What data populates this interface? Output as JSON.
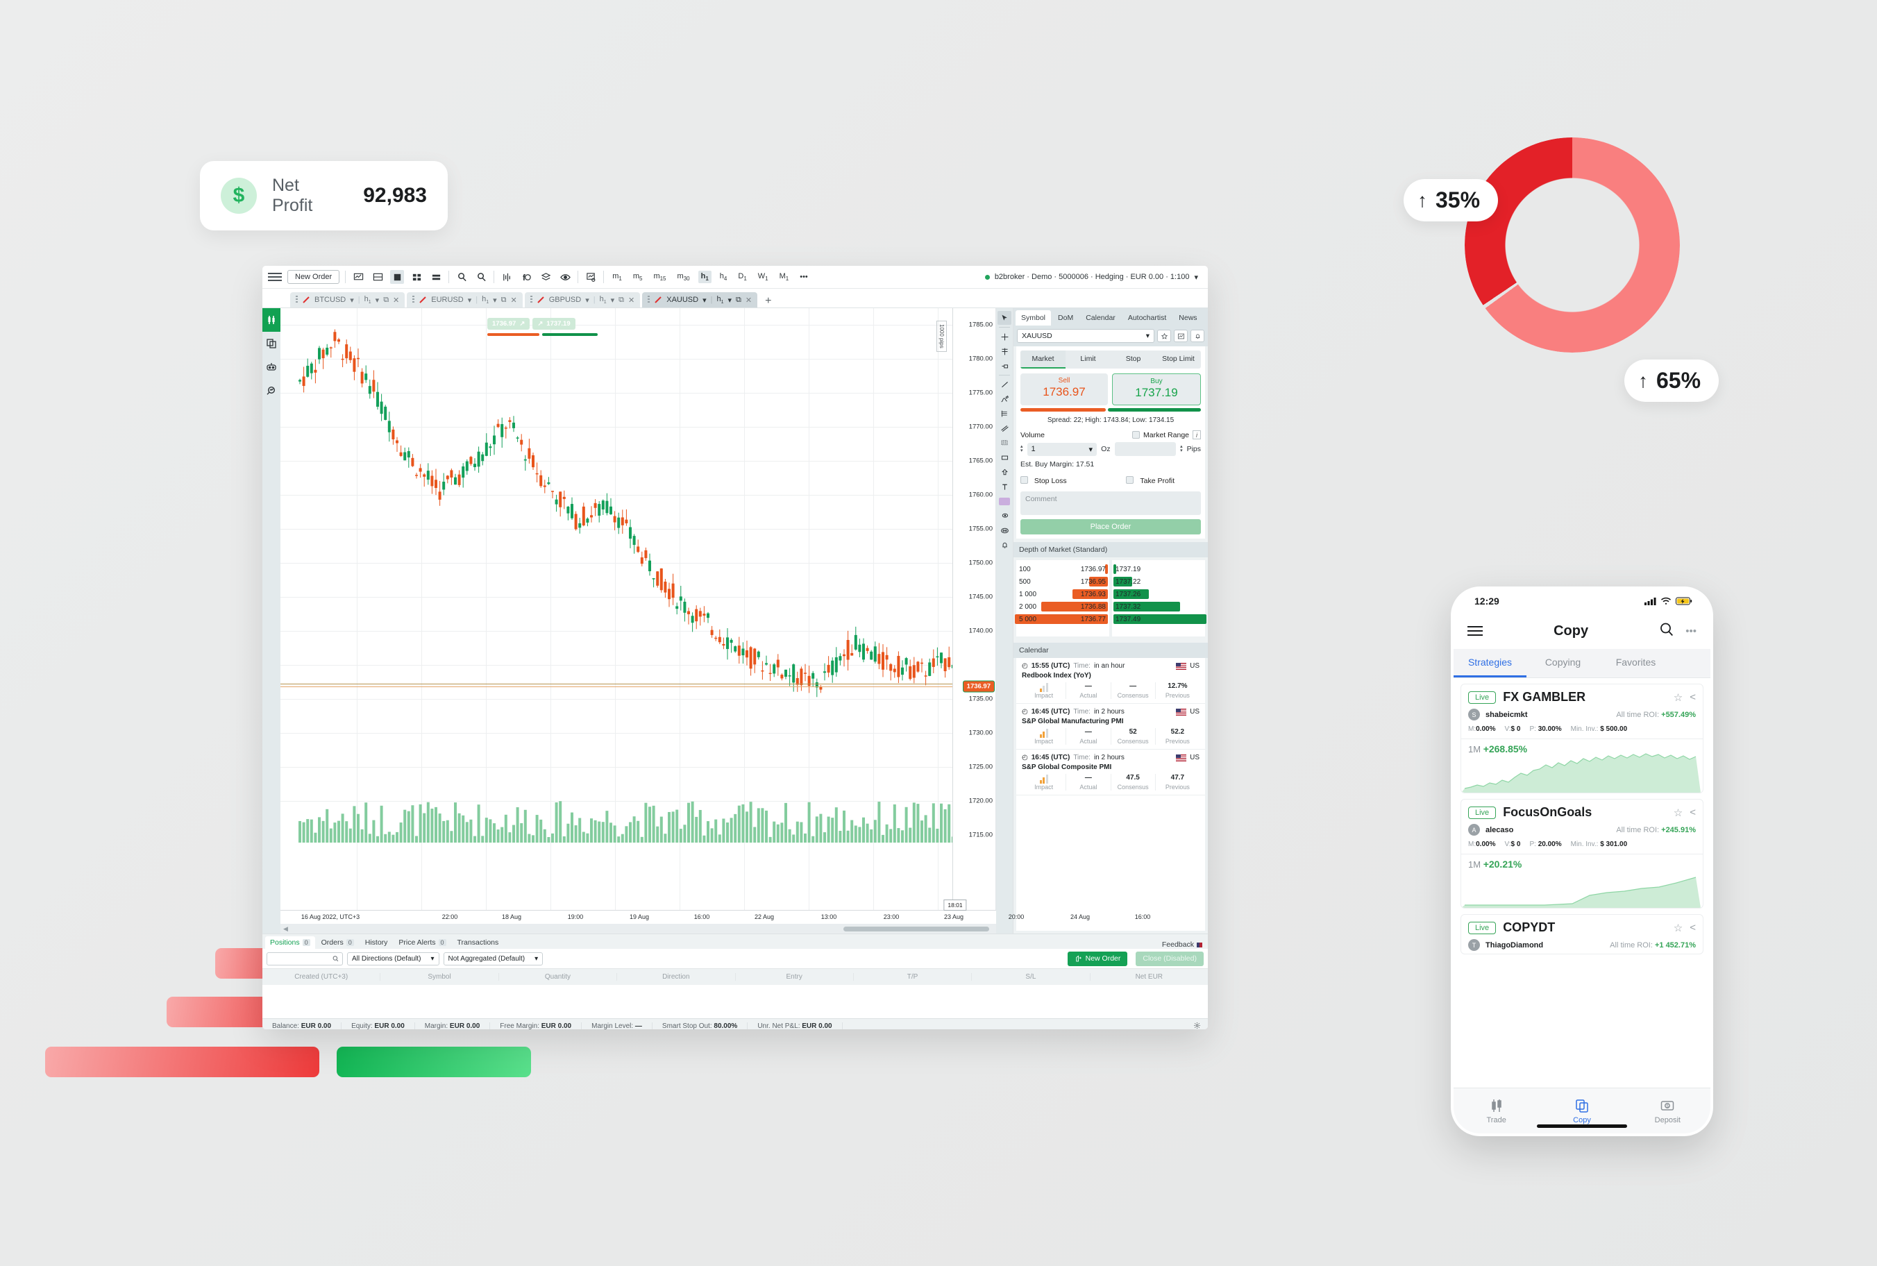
{
  "net_profit_card": {
    "icon": "dollar-icon",
    "label": "Net Profit",
    "value": "92,983"
  },
  "donut": {
    "top_label": "35%",
    "bottom_label": "65%",
    "arrow": "↑",
    "colors": {
      "primary": "#e32128",
      "secondary": "#f97f7f"
    }
  },
  "chart_data": {
    "type": "candlestick",
    "title": "XAUUSD h1",
    "symbol": "XAUUSD",
    "timeframe": "h1",
    "xlabel": "16 Aug 2022, UTC+3",
    "ylabel": "",
    "ylim": [
      1710,
      1788
    ],
    "y_ticks": [
      "1785.00",
      "1780.00",
      "1775.00",
      "1770.00",
      "1765.00",
      "1760.00",
      "1755.00",
      "1750.00",
      "1745.00",
      "1740.00",
      "1735.00",
      "1730.00",
      "1725.00",
      "1720.00",
      "1715.00"
    ],
    "x_ticks": [
      "16 Aug 2022, UTC+3",
      "22:00",
      "18 Aug",
      "19:00",
      "19 Aug",
      "16:00",
      "22 Aug",
      "13:00",
      "23:00",
      "23 Aug",
      "20:00",
      "24 Aug",
      "16:00"
    ],
    "last_price_label": "1736.97",
    "crosshair_label": "18:01",
    "scale_note": "1000 pips",
    "top_bid_label": "1736.97",
    "top_ask_label": "1737.19",
    "grid": true,
    "series": [
      {
        "name": "XAUUSD h1 OHLC",
        "note": "Downtrend from ~1784 to ~1735 across 16–24 Aug 2022"
      }
    ],
    "volume_note": "Volume histogram below price panel (green)"
  },
  "app": {
    "toolbar": {
      "menu_icon": "hamburger-icon",
      "new_order": "New Order",
      "icons": [
        "chart-screen-icon",
        "split-screen-icon",
        "fill-square-icon",
        "grid-4-icon",
        "grid-2-icon",
        "zoom-in-icon",
        "zoom-out-icon",
        "indicator-icon",
        "fibonacci-icon",
        "layers-icon",
        "eye-icon",
        "chart-settings-icon"
      ],
      "timeframes": [
        {
          "label": "m",
          "sub": "1",
          "active": false
        },
        {
          "label": "m",
          "sub": "5",
          "active": false
        },
        {
          "label": "m",
          "sub": "15",
          "active": false
        },
        {
          "label": "m",
          "sub": "30",
          "active": false
        },
        {
          "label": "h",
          "sub": "1",
          "active": true
        },
        {
          "label": "h",
          "sub": "4",
          "active": false
        },
        {
          "label": "D",
          "sub": "1",
          "active": false
        },
        {
          "label": "W",
          "sub": "1",
          "active": false
        },
        {
          "label": "M",
          "sub": "1",
          "active": false
        }
      ],
      "more": "•••",
      "account": "b2broker · Demo · 5000006 · Hedging · EUR 0.00 · 1:100"
    },
    "chart_tabs": [
      {
        "symbol": "BTCUSD",
        "tf": "h1",
        "active": false
      },
      {
        "symbol": "EURUSD",
        "tf": "h1",
        "active": false
      },
      {
        "symbol": "GBPUSD",
        "tf": "h1",
        "active": false
      },
      {
        "symbol": "XAUUSD",
        "tf": "h1",
        "active": true
      }
    ],
    "add_tab": "+",
    "left_rail": [
      "candlestick-icon",
      "copy-icon",
      "robot-icon",
      "search-chart-icon"
    ],
    "draw_tools": [
      "cursor-icon",
      "crosshair-icon",
      "magnet-icon",
      "anchor-icon",
      "trendline-icon",
      "freehand-icon",
      "fibonacci-icon",
      "parallel-channel-icon",
      "grid-icon",
      "rectangle-icon",
      "arrow-up-icon",
      "text-icon",
      "color-swatch-icon",
      "ellipse-icon",
      "emoji-icon",
      "alert-bell-icon"
    ],
    "right_panel": {
      "tabs": [
        "Symbol",
        "DoM",
        "Calendar",
        "Autochartist",
        "News"
      ],
      "active_tab": "Symbol",
      "symbol_select": "XAUUSD",
      "symbol_actions": [
        "star-icon",
        "chart-icon",
        "bell-icon"
      ],
      "order_types": [
        "Market",
        "Limit",
        "Stop",
        "Stop Limit"
      ],
      "active_order_type": "Market",
      "sell": {
        "label": "Sell",
        "price": "1736.97"
      },
      "buy": {
        "label": "Buy",
        "price": "1737.19"
      },
      "spread_line": "Spread: 22; High: 1743.84; Low: 1734.15",
      "volume_label": "Volume",
      "volume_value": "1",
      "volume_unit": "Oz",
      "market_range_label": "Market Range",
      "market_range_info": "i",
      "pips_label": "Pips",
      "est_margin": "Est. Buy Margin: 17.51",
      "stop_loss": "Stop Loss",
      "take_profit": "Take Profit",
      "comment_placeholder": "Comment",
      "place_order": "Place Order",
      "dom_header": "Depth of Market (Standard)",
      "dom_ask_rows": [
        {
          "qty": "100",
          "price": "1736.97",
          "width": 3
        },
        {
          "qty": "500",
          "price": "1736.95",
          "width": 20
        },
        {
          "qty": "1 000",
          "price": "1736.93",
          "width": 38
        },
        {
          "qty": "2 000",
          "price": "1736.88",
          "width": 72
        },
        {
          "qty": "5 000",
          "price": "1736.77",
          "width": 100
        }
      ],
      "dom_bid_rows": [
        {
          "price": "1737.19",
          "width": 3
        },
        {
          "price": "1737.22",
          "width": 20
        },
        {
          "price": "1737.26",
          "width": 38
        },
        {
          "price": "1737.32",
          "width": 72
        },
        {
          "price": "1737.49",
          "width": 100
        }
      ],
      "calendar_header": "Calendar",
      "calendar_columns": [
        "Impact",
        "Actual",
        "Consensus",
        "Previous"
      ],
      "calendar_items": [
        {
          "time": "15:55 (UTC)",
          "time_label": "Time:",
          "when": "in an hour",
          "country": "US",
          "title": "Redbook Index (YoY)",
          "impact": 1,
          "actual": "—",
          "consensus": "—",
          "previous": "12.7%"
        },
        {
          "time": "16:45 (UTC)",
          "time_label": "Time:",
          "when": "in 2 hours",
          "country": "US",
          "title": "S&P Global Manufacturing PMI",
          "impact": 2,
          "actual": "—",
          "consensus": "52",
          "previous": "52.2"
        },
        {
          "time": "16:45 (UTC)",
          "time_label": "Time:",
          "when": "in 2 hours",
          "country": "US",
          "title": "S&P Global Composite PMI",
          "impact": 2,
          "actual": "—",
          "consensus": "47.5",
          "previous": "47.7"
        }
      ]
    },
    "bottom": {
      "tabs": [
        {
          "label": "Positions",
          "count": "0",
          "active": true
        },
        {
          "label": "Orders",
          "count": "0",
          "active": false
        },
        {
          "label": "History",
          "count": "",
          "active": false
        },
        {
          "label": "Price Alerts",
          "count": "0",
          "active": false
        },
        {
          "label": "Transactions",
          "count": "",
          "active": false
        }
      ],
      "feedback": "Feedback",
      "search_placeholder": "",
      "direction_filter": "All Directions (Default)",
      "aggregation_filter": "Not Aggregated (Default)",
      "new_order": "New Order",
      "close_disabled": "Close (Disabled)",
      "columns": [
        "Created (UTC+3)",
        "Symbol",
        "Quantity",
        "Direction",
        "Entry",
        "T/P",
        "S/L",
        "Net EUR"
      ]
    },
    "status": [
      {
        "key": "Balance:",
        "value": "EUR 0.00"
      },
      {
        "key": "Equity:",
        "value": "EUR 0.00"
      },
      {
        "key": "Margin:",
        "value": "EUR 0.00"
      },
      {
        "key": "Free Margin:",
        "value": "EUR 0.00"
      },
      {
        "key": "Margin Level:",
        "value": "—"
      },
      {
        "key": "Smart Stop Out:",
        "value": "80.00%"
      },
      {
        "key": "Unr. Net P&L:",
        "value": "EUR 0.00"
      }
    ],
    "status_gear": "gear-icon"
  },
  "phone": {
    "status_time": "12:29",
    "status_icons": [
      "signal-icon",
      "wifi-icon",
      "battery-charging-icon"
    ],
    "nav": {
      "menu": "hamburger-icon",
      "title": "Copy",
      "search": "search-icon",
      "more": "more-icon"
    },
    "tabs": [
      {
        "label": "Strategies",
        "active": true
      },
      {
        "label": "Copying",
        "active": false
      },
      {
        "label": "Favorites",
        "active": false
      }
    ],
    "strategies": [
      {
        "badge": "Live",
        "name": "FX GAMBLER",
        "avatar": "S",
        "user": "shabeicmkt",
        "roi_label": "All time ROI:",
        "roi": "+557.49%",
        "m_label": "M:",
        "m": "0.00%",
        "v_label": "V:",
        "v": "$ 0",
        "p_label": "P:",
        "p": "30.00%",
        "min_label": "Min. Inv.:",
        "min": "$ 500.00",
        "period": "1M",
        "perf": "+268.85%",
        "spark": "5,52 14,50 23,47 32,49 41,44 50,46 59,40 68,43 77,36 86,30 95,33 104,26 113,24 122,18 131,22 140,15 149,19 158,12 167,16 176,9 185,13 194,7 203,11 212,5 221,9 230,4 239,8 248,3 257,7 266,2 275,6 284,3 293,8 302,4 311,9 320,5 329,10 338,6"
      },
      {
        "badge": "Live",
        "name": "FocusOnGoals",
        "avatar": "A",
        "user": "alecaso",
        "roi_label": "All time ROI:",
        "roi": "+245.91%",
        "m_label": "M:",
        "m": "0.00%",
        "v_label": "V:",
        "v": "$ 0",
        "p_label": "P:",
        "p": "20.00%",
        "min_label": "Min. Inv.:",
        "min": "$ 301.00",
        "period": "1M",
        "perf": "+20.21%",
        "spark": "5,54 60,54 120,54 160,52 185,40 210,36 235,34 260,30 285,28 310,22 338,14"
      },
      {
        "badge": "Live",
        "name": "COPYDT",
        "avatar": "T",
        "user": "ThiagoDiamond",
        "roi_label": "All time ROI:",
        "roi": "+1 452.71%",
        "m_label": "M:",
        "m": "",
        "v_label": "V:",
        "v": "",
        "p_label": "P:",
        "p": "",
        "min_label": "",
        "min": "",
        "period": "",
        "perf": "",
        "spark": ""
      }
    ],
    "bottom_nav": [
      {
        "label": "Trade",
        "icon": "candlestick-icon",
        "active": false
      },
      {
        "label": "Copy",
        "icon": "copy-icon",
        "active": true
      },
      {
        "label": "Deposit",
        "icon": "deposit-icon",
        "active": false
      }
    ]
  }
}
